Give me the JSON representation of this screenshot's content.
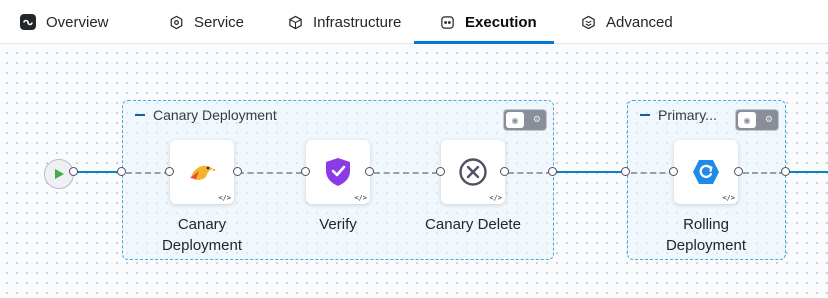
{
  "tabs": [
    {
      "label": "Overview",
      "icon": "pipeline-icon",
      "active": false
    },
    {
      "label": "Service",
      "icon": "hexagon-icon",
      "active": false
    },
    {
      "label": "Infrastructure",
      "icon": "cube-icon",
      "active": false
    },
    {
      "label": "Execution",
      "icon": "execution-icon",
      "active": true
    },
    {
      "label": "Advanced",
      "icon": "cube-stack-icon",
      "active": false
    }
  ],
  "colors": {
    "accent": "#0278d5",
    "wire": "#0b84c6",
    "group_border": "#46a8dc"
  },
  "stages": [
    {
      "name": "Canary Deployment",
      "steps": [
        {
          "label_lines": [
            "Canary",
            "Deployment"
          ],
          "icon": "canary-bird-icon"
        },
        {
          "label_lines": [
            "Verify"
          ],
          "icon": "verify-shield-icon"
        },
        {
          "label_lines": [
            "Canary Delete"
          ],
          "icon": "delete-circle-icon"
        }
      ]
    },
    {
      "name": "Primary...",
      "steps": [
        {
          "label_lines": [
            "Rolling",
            "Deployment"
          ],
          "icon": "rolling-deploy-icon"
        }
      ]
    }
  ],
  "badge_text": "</>"
}
